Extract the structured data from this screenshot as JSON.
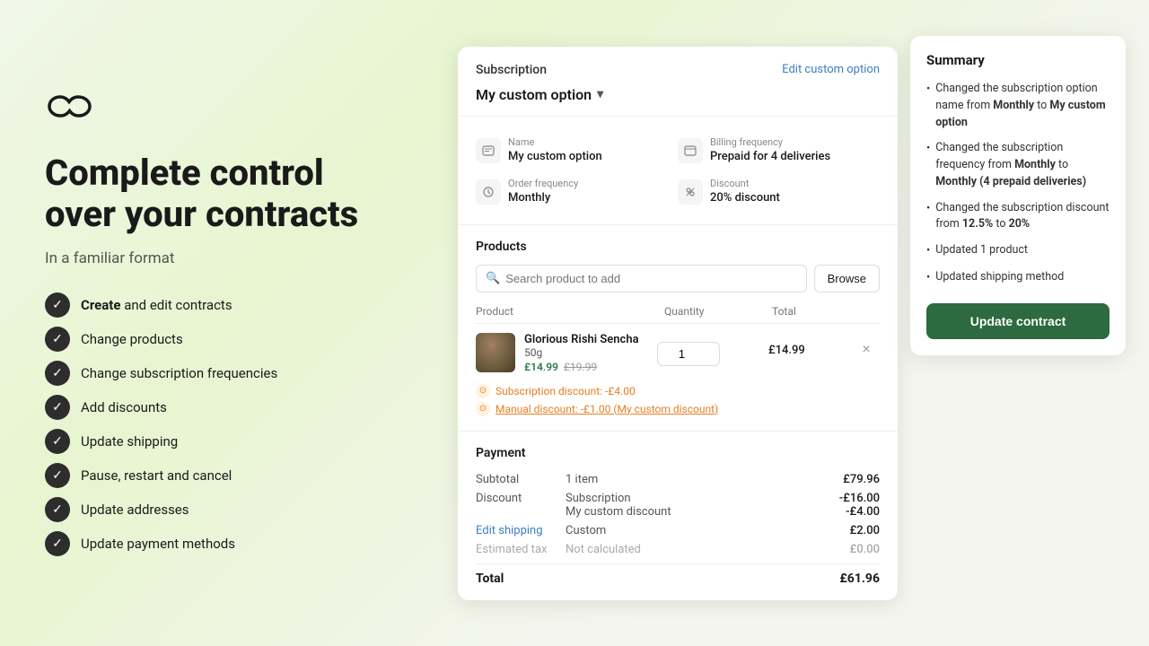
{
  "left": {
    "hero_title_line1": "Complete control",
    "hero_title_line2": "over your contracts",
    "hero_subtitle": "In a familiar format",
    "features": [
      {
        "id": "create",
        "bold": "Create",
        "rest": " and edit contracts"
      },
      {
        "id": "change-products",
        "bold": "",
        "rest": "Change products"
      },
      {
        "id": "change-freq",
        "bold": "",
        "rest": "Change subscription frequencies"
      },
      {
        "id": "discounts",
        "bold": "",
        "rest": "Add discounts"
      },
      {
        "id": "shipping",
        "bold": "",
        "rest": "Update shipping"
      },
      {
        "id": "pause",
        "bold": "",
        "rest": "Pause, restart and cancel"
      },
      {
        "id": "addresses",
        "bold": "",
        "rest": "Update addresses"
      },
      {
        "id": "payment",
        "bold": "",
        "rest": "Update payment methods"
      }
    ]
  },
  "subscription": {
    "label": "Subscription",
    "edit_custom_label": "Edit custom option",
    "selected_option": "My custom option",
    "fields": {
      "name_label": "Name",
      "name_value": "My custom option",
      "billing_label": "Billing frequency",
      "billing_value": "Prepaid for 4 deliveries",
      "order_label": "Order frequency",
      "order_value": "Monthly",
      "discount_label": "Discount",
      "discount_value": "20% discount"
    }
  },
  "products": {
    "section_title": "Products",
    "search_placeholder": "Search product to add",
    "browse_label": "Browse",
    "table_headers": {
      "product": "Product",
      "quantity": "Quantity",
      "total": "Total"
    },
    "items": [
      {
        "name": "Glorious Rishi Sencha",
        "variant": "50g",
        "price_current": "£14.99",
        "price_original": "£19.99",
        "quantity": 1,
        "total": "£14.99",
        "discounts": [
          {
            "type": "sub",
            "text": "Subscription discount: -£4.00"
          },
          {
            "type": "manual",
            "text": "Manual discount: -£1.00 (My custom discount)"
          }
        ]
      }
    ]
  },
  "payment": {
    "section_title": "Payment",
    "rows": [
      {
        "label": "Subtotal",
        "desc": "1 item",
        "amount": "£79.96"
      },
      {
        "label": "Discount",
        "descs": [
          "Subscription",
          "My custom discount"
        ],
        "amounts": [
          "-£16.00",
          "-£4.00"
        ]
      },
      {
        "label": "Edit shipping",
        "is_link": true,
        "desc": "Custom",
        "amount": "£2.00"
      },
      {
        "label": "Estimated tax",
        "is_muted": true,
        "desc": "Not calculated",
        "amount": "£0.00"
      }
    ],
    "total_label": "Total",
    "total_amount": "£61.96"
  },
  "summary": {
    "title": "Summary",
    "items": [
      {
        "text": "Changed the subscription option name from <b>Monthly</b> to <b>My custom option</b>"
      },
      {
        "text": "Changed the subscription frequency from <b>Monthly</b> to <b>Monthly (4 prepaid deliveries)</b>"
      },
      {
        "text": "Changed the subscription discount from <b>12.5%</b> to <b>20%</b>"
      },
      {
        "text": "Updated 1 product"
      },
      {
        "text": "Updated shipping method"
      }
    ],
    "update_button_label": "Update contract"
  }
}
